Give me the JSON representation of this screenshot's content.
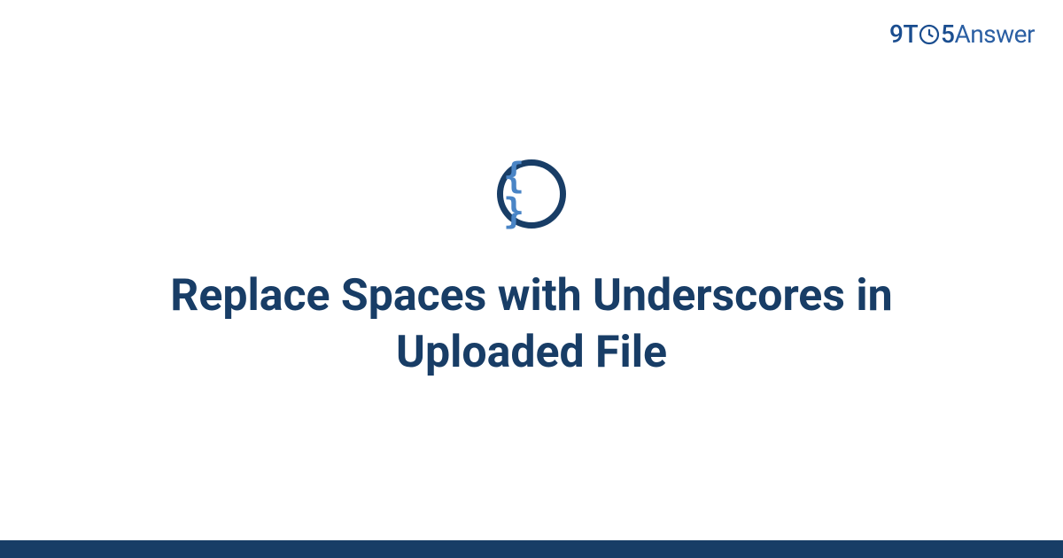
{
  "header": {
    "logo": {
      "part1": "9",
      "part2": "T",
      "part4": "5",
      "part5": "Answer"
    }
  },
  "badge": {
    "glyph": "{ }",
    "icon_name": "code-braces-icon"
  },
  "main": {
    "title": "Replace Spaces with Underscores in Uploaded File"
  },
  "colors": {
    "primary_dark": "#183d66",
    "primary_mid": "#1a4d8f",
    "accent_blue": "#4a85c6"
  }
}
